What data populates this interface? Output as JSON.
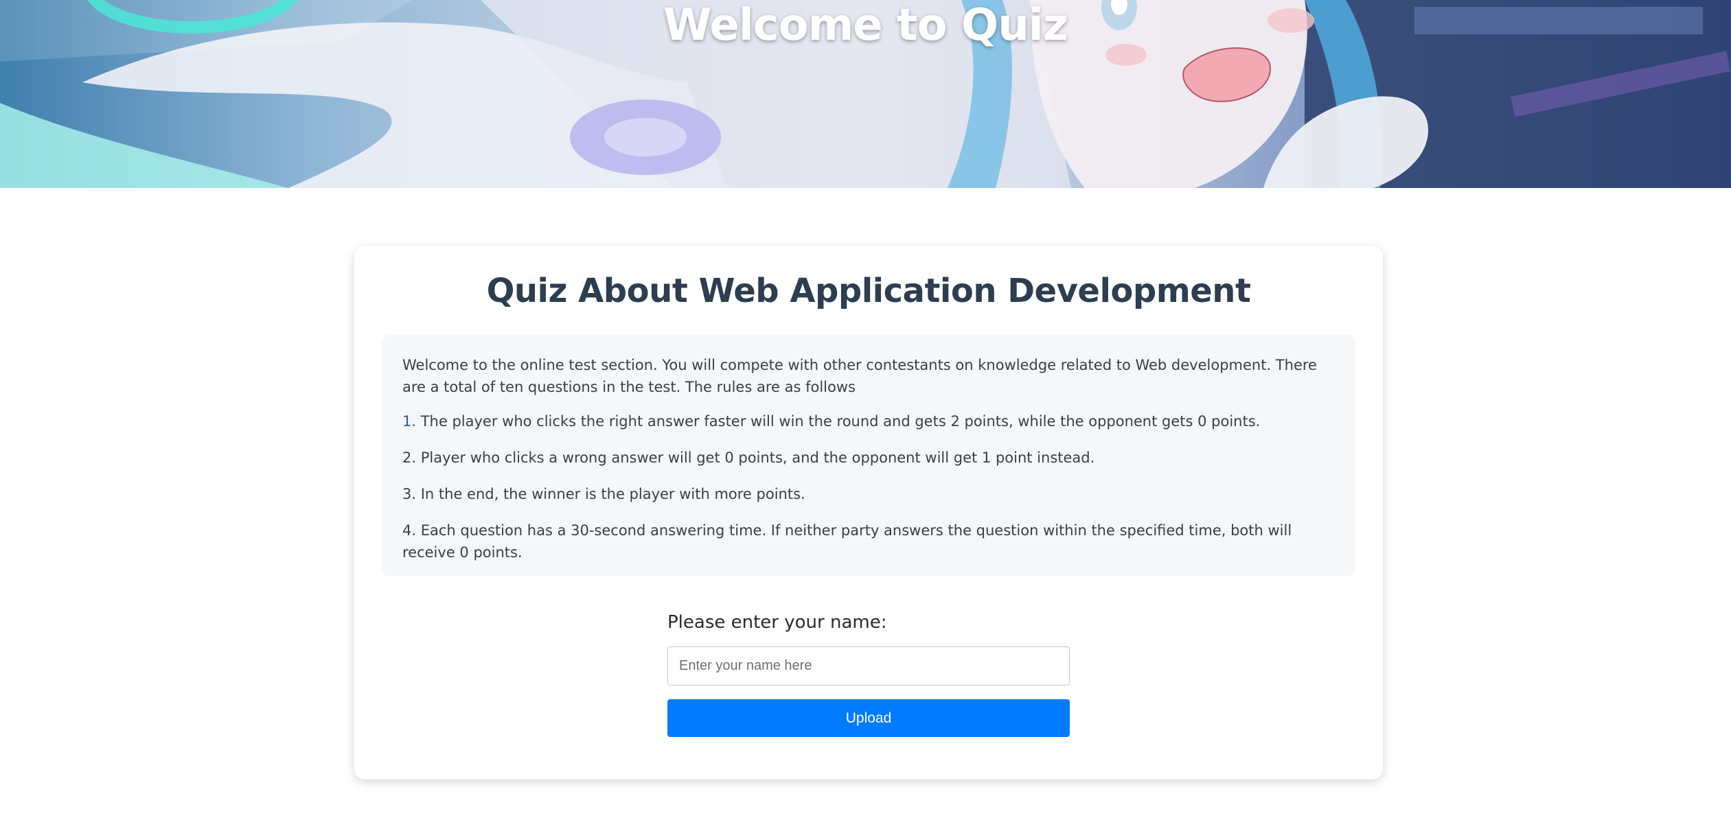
{
  "hero": {
    "title": "Welcome to Quiz"
  },
  "card": {
    "title": "Quiz About Web Application Development",
    "intro": "Welcome to the online test section. You will compete with other contestants on knowledge related to Web development. There are a total of ten questions in the test. The rules are as follows",
    "rules": [
      {
        "num": "1.",
        "text": " The player who clicks the right answer faster will win the round and gets 2 points, while the opponent gets 0 points."
      },
      {
        "num": "2.",
        "text": " Player who clicks a wrong answer will get 0 points, and the opponent will get 1 point instead."
      },
      {
        "num": "3.",
        "text": " In the end, the winner is the player with more points."
      },
      {
        "num": "4.",
        "text": " Each question has a 30-second answering time. If neither party answers the question within the specified time, both will receive 0 points."
      }
    ]
  },
  "form": {
    "label": "Please enter your name:",
    "input_placeholder": "Enter your name here",
    "input_value": "",
    "button_label": "Upload"
  },
  "colors": {
    "primary_button": "#007bff",
    "title_text": "#2c3e50",
    "rules_background": "#f5f7f9"
  }
}
